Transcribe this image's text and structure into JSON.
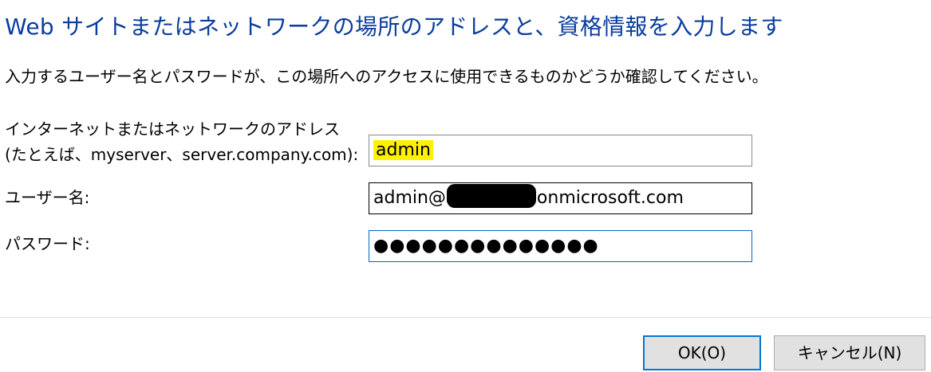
{
  "dialog": {
    "title": "Web サイトまたはネットワークの場所のアドレスと、資格情報を入力します",
    "description": "入力するユーザー名とパスワードが、この場所へのアクセスに使用できるものかどうか確認してください。"
  },
  "fields": {
    "address": {
      "label_line1": "インターネットまたはネットワークのアドレス",
      "label_line2": "(たとえば、myserver、server.company.com):",
      "value": "admin"
    },
    "username": {
      "label": "ユーザー名:",
      "value_prefix": "admin@",
      "value_suffix": ".onmicrosoft.com"
    },
    "password": {
      "label": "パスワード:",
      "masked_value": "●●●●●●●●●●●●●●"
    }
  },
  "buttons": {
    "ok": "OK(O)",
    "cancel": "キャンセル(N)"
  },
  "colors": {
    "title": "#0a3d9e",
    "highlight": "#fff200",
    "focus_border": "#0a64c8",
    "default_button_border": "#0078d7"
  }
}
